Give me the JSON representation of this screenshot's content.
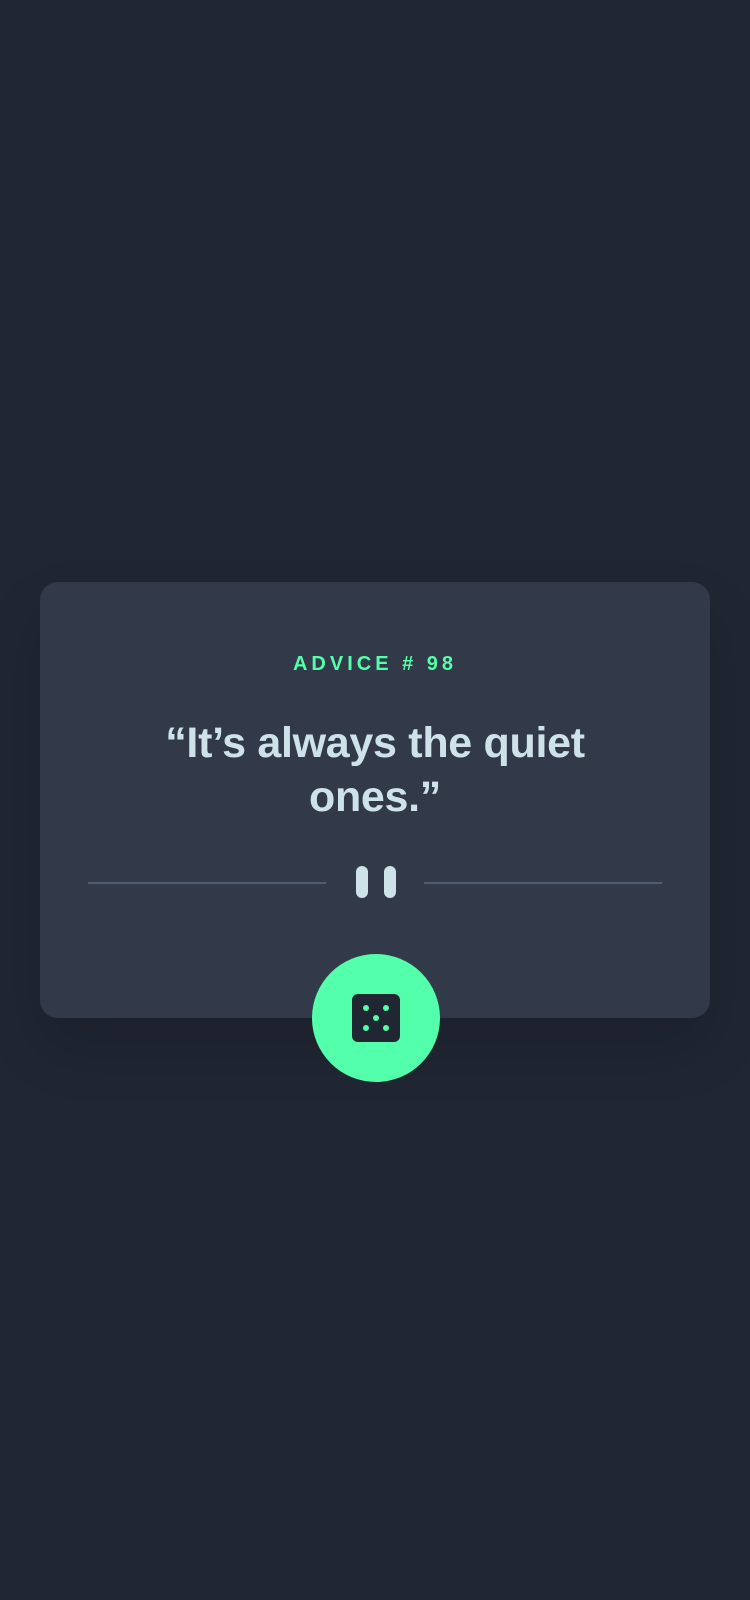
{
  "advice": {
    "label": "ADVICE # 98",
    "quote": "“It’s always the quiet ones.”"
  },
  "icons": {
    "divider": "pause-icon",
    "button": "dice-icon"
  },
  "colors": {
    "background": "#202632",
    "card": "#323a49",
    "accent": "#53ffaa",
    "text": "#cee3e9",
    "divider": "#4f5d74"
  }
}
